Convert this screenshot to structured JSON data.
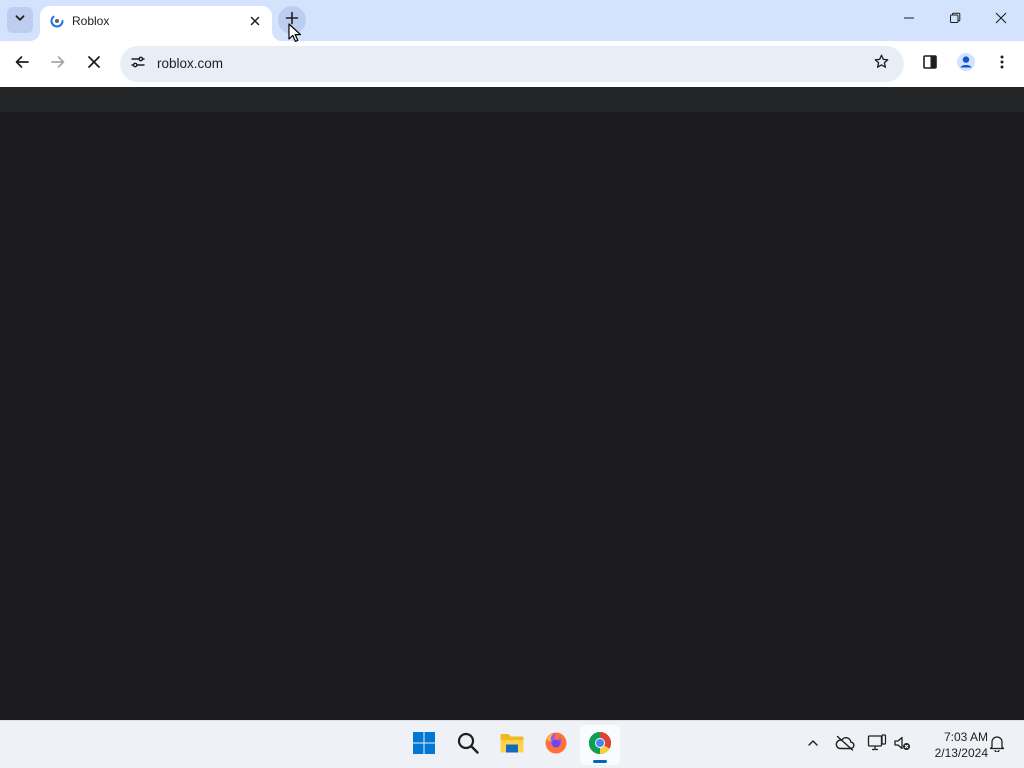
{
  "browser": {
    "tab": {
      "title": "Roblox",
      "favicon": "loading-spinner-icon",
      "close_icon": "close-icon"
    },
    "new_tab_icon": "plus-icon",
    "tab_search_icon": "chevron-down-icon",
    "window_controls": [
      "minimize-icon",
      "restore-icon",
      "close-icon"
    ],
    "toolbar": {
      "back_icon": "arrow-left-icon",
      "forward_icon": "arrow-right-icon",
      "stop_icon": "close-icon",
      "site_info_icon": "tune-icon",
      "url": "roblox.com",
      "bookmark_icon": "star-icon",
      "side_panel_icon": "side-panel-icon",
      "profile_icon": "profile-icon",
      "menu_icon": "more-vertical-icon"
    }
  },
  "page": {
    "background": "#1c1c1e",
    "topbar_color": "#232527"
  },
  "taskbar": {
    "apps": [
      "windows-start-icon",
      "search-icon",
      "file-explorer-icon",
      "firefox-icon",
      "chrome-icon"
    ],
    "active_app": "chrome-icon",
    "tray": [
      "chevron-up-icon",
      "onedrive-offline-icon",
      "network-icon",
      "volume-muted-icon"
    ],
    "clock": {
      "time": "7:03 AM",
      "date": "2/13/2024"
    },
    "notification_icon": "bell-icon"
  },
  "colors": {
    "tabstrip": "#d3e3fd",
    "omnibox": "#e9eef6",
    "accent": "#0067c0"
  }
}
